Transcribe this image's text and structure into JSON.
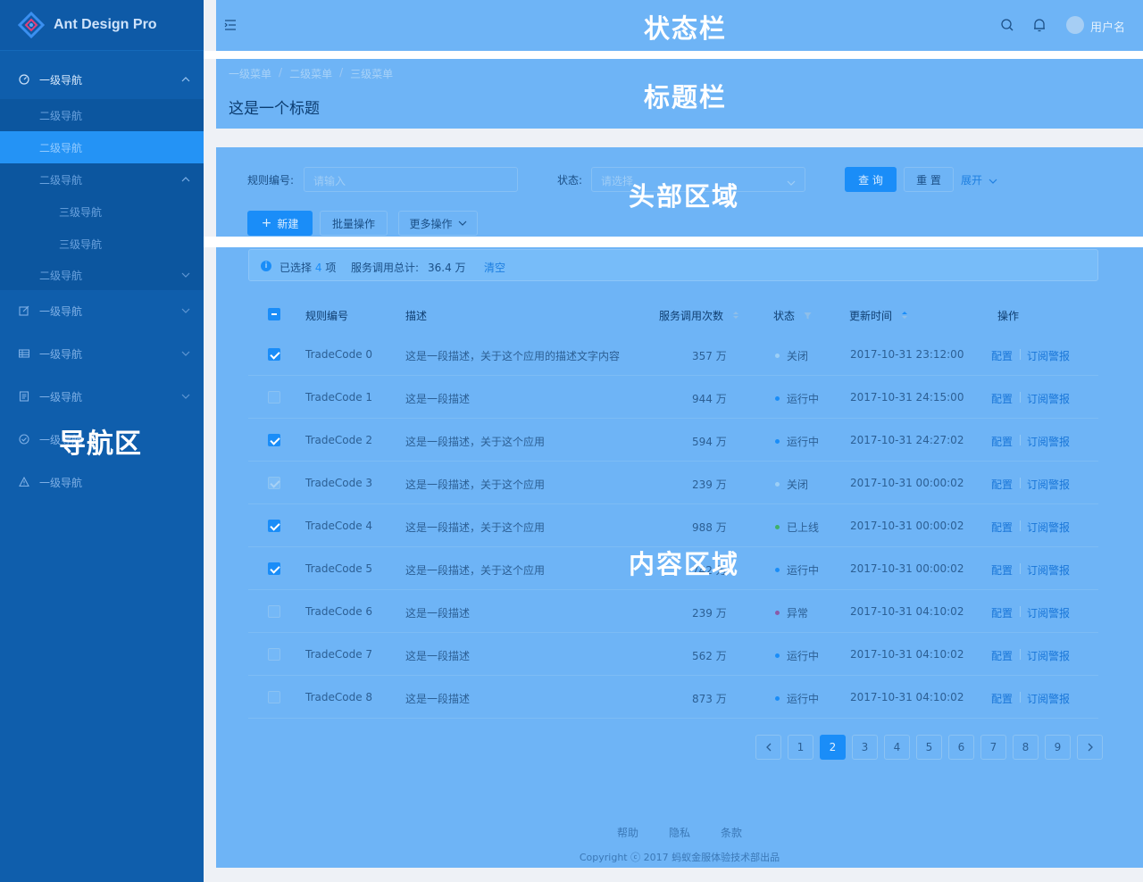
{
  "app": {
    "title": "Ant Design Pro"
  },
  "zones": {
    "status_bar": "状态栏",
    "title_bar": "标题栏",
    "header_area": "头部区域",
    "content_area": "内容区域",
    "nav_area": "导航区"
  },
  "sidebar": {
    "items": [
      {
        "label": "一级导航",
        "icon": "dashboard-icon",
        "expanded": true
      },
      {
        "label": "二级导航"
      },
      {
        "label": "二级导航",
        "active": true
      },
      {
        "label": "二级导航",
        "expanded": true
      },
      {
        "label": "三级导航"
      },
      {
        "label": "三级导航"
      },
      {
        "label": "二级导航"
      },
      {
        "label": "一级导航",
        "icon": "form-edit-icon"
      },
      {
        "label": "一级导航",
        "icon": "table-icon"
      },
      {
        "label": "一级导航",
        "icon": "profile-icon"
      },
      {
        "label": "一级导航",
        "icon": "check-circle-icon"
      },
      {
        "label": "一级导航",
        "icon": "warning-icon"
      }
    ]
  },
  "header": {
    "username": "用户名"
  },
  "titlebar": {
    "breadcrumb": [
      "一级菜单",
      "二级菜单",
      "三级菜单"
    ],
    "separator": "/",
    "page_title": "这是一个标题"
  },
  "filter": {
    "rule_label": "规则编号:",
    "rule_placeholder": "请输入",
    "status_label": "状态:",
    "status_placeholder": "请选择",
    "query": "查 询",
    "reset": "重 置",
    "expand": "展开",
    "new": "新建",
    "batch": "批量操作",
    "more": "更多操作"
  },
  "alert": {
    "selected_prefix": "已选择",
    "selected_count": "4",
    "selected_suffix": "项",
    "total_label": "服务调用总计:",
    "total_value": "36.4 万",
    "clear": "清空"
  },
  "table": {
    "columns": [
      "规则编号",
      "描述",
      "服务调用次数",
      "状态",
      "更新时间",
      "操作"
    ],
    "rows": [
      {
        "check": "on",
        "code": "TradeCode 0",
        "desc": "这是一段描述，关于这个应用的描述文字内容",
        "calls": "357 万",
        "status": "关闭",
        "status_color": "#9ccff6",
        "time": "2017-10-31  23:12:00",
        "a1": "配置",
        "a2": "订阅警报"
      },
      {
        "check": "off",
        "code": "TradeCode 1",
        "desc": "这是一段描述",
        "calls": "944 万",
        "status": "运行中",
        "status_color": "#1a8df8",
        "time": "2017-10-31  24:15:00",
        "a1": "配置",
        "a2": "订阅警报"
      },
      {
        "check": "on",
        "code": "TradeCode 2",
        "desc": "这是一段描述，关于这个应用",
        "calls": "594 万",
        "status": "运行中",
        "status_color": "#1a8df8",
        "time": "2017-10-31  24:27:02",
        "a1": "配置",
        "a2": "订阅警报"
      },
      {
        "check": "faint",
        "code": "TradeCode 3",
        "desc": "这是一段描述，关于这个应用",
        "calls": "239 万",
        "status": "关闭",
        "status_color": "#9ccff6",
        "time": "2017-10-31  00:00:02",
        "a1": "配置",
        "a2": "订阅警报"
      },
      {
        "check": "on",
        "code": "TradeCode 4",
        "desc": "这是一段描述，关于这个应用",
        "calls": "988 万",
        "status": "已上线",
        "status_color": "#3fb06a",
        "time": "2017-10-31  00:00:02",
        "a1": "配置",
        "a2": "订阅警报"
      },
      {
        "check": "on",
        "code": "TradeCode 5",
        "desc": "这是一段描述，关于这个应用",
        "calls": "742 万",
        "status": "运行中",
        "status_color": "#1a8df8",
        "time": "2017-10-31  00:00:02",
        "a1": "配置",
        "a2": "订阅警报"
      },
      {
        "check": "off",
        "code": "TradeCode 6",
        "desc": "这是一段描述",
        "calls": "239 万",
        "status": "异常",
        "status_color": "#8a5aa8",
        "time": "2017-10-31  04:10:02",
        "a1": "配置",
        "a2": "订阅警报"
      },
      {
        "check": "off",
        "code": "TradeCode 7",
        "desc": "这是一段描述",
        "calls": "562 万",
        "status": "运行中",
        "status_color": "#1a8df8",
        "time": "2017-10-31  04:10:02",
        "a1": "配置",
        "a2": "订阅警报"
      },
      {
        "check": "off",
        "code": "TradeCode 8",
        "desc": "这是一段描述",
        "calls": "873 万",
        "status": "运行中",
        "status_color": "#1a8df8",
        "time": "2017-10-31  04:10:02",
        "a1": "配置",
        "a2": "订阅警报"
      }
    ]
  },
  "pagination": {
    "pages": [
      "1",
      "2",
      "3",
      "4",
      "5",
      "6",
      "7",
      "8",
      "9"
    ],
    "current": "2"
  },
  "footer": {
    "links": [
      "帮助",
      "隐私",
      "条款"
    ],
    "copyright": "Copyright ⓒ 2017 蚂蚁金服体验技术部出品"
  },
  "colors": {
    "sidebar": "#0f5eac",
    "overlay": "#6eb4f6",
    "primary": "#1a8df8"
  }
}
